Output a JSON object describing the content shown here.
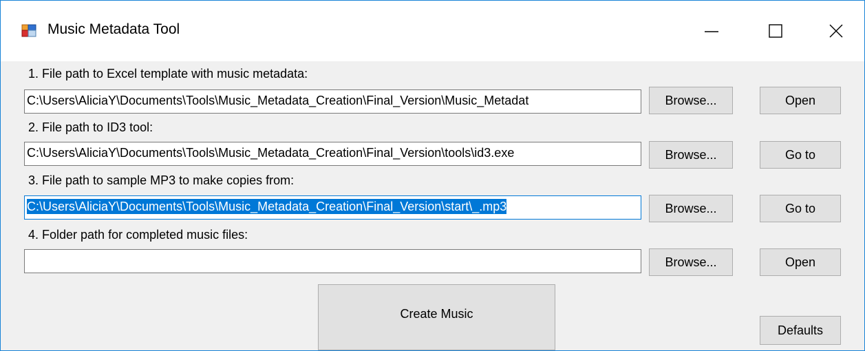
{
  "window": {
    "title": "Music Metadata Tool",
    "icon": "app-form-icon",
    "controls": [
      "minimize-icon",
      "maximize-icon",
      "close-icon"
    ]
  },
  "fields": [
    {
      "label": "1. File path to Excel template with music metadata:",
      "value": "C:\\Users\\AliciaY\\Documents\\Tools\\Music_Metadata_Creation\\Final_Version\\Music_Metadat",
      "browse_label": "Browse...",
      "action_label": "Open"
    },
    {
      "label": "2. File path to ID3 tool:",
      "value": "C:\\Users\\AliciaY\\Documents\\Tools\\Music_Metadata_Creation\\Final_Version\\tools\\id3.exe",
      "browse_label": "Browse...",
      "action_label": "Go to"
    },
    {
      "label": "3. File path to sample MP3 to make copies from:",
      "value": "C:\\Users\\AliciaY\\Documents\\Tools\\Music_Metadata_Creation\\Final_Version\\start\\_.mp3",
      "browse_label": "Browse...",
      "action_label": "Go to"
    },
    {
      "label": "4. Folder path for completed music files:",
      "value": "",
      "browse_label": "Browse...",
      "action_label": "Open"
    }
  ],
  "buttons": {
    "create": "Create Music",
    "defaults": "Defaults"
  },
  "colors": {
    "window_border": "#1883d7",
    "selection": "#0078d7",
    "button_face": "#e1e1e1"
  }
}
